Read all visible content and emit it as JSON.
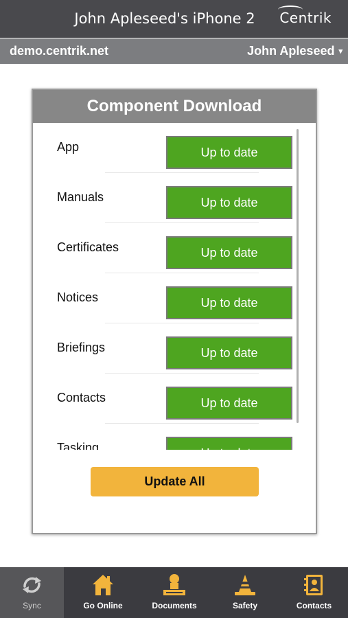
{
  "header": {
    "device_title": "John Apleseed's iPhone 2",
    "logo_text": "Centrik"
  },
  "subheader": {
    "server": "demo.centrik.net",
    "user": "John Apleseed",
    "user_caret": "▾"
  },
  "dialog": {
    "title": "Component Download",
    "components": [
      {
        "label": "App",
        "status": "Up to date"
      },
      {
        "label": "Manuals",
        "status": "Up to date"
      },
      {
        "label": "Certificates",
        "status": "Up to date"
      },
      {
        "label": "Notices",
        "status": "Up to date"
      },
      {
        "label": "Briefings",
        "status": "Up to date"
      },
      {
        "label": "Contacts",
        "status": "Up to date"
      },
      {
        "label": "Tasking",
        "status": "Up to date"
      }
    ],
    "update_all_label": "Update All"
  },
  "tabbar": {
    "tabs": [
      {
        "label": "Sync",
        "icon": "sync-icon",
        "active": true
      },
      {
        "label": "Go Online",
        "icon": "home-icon",
        "active": false
      },
      {
        "label": "Documents",
        "icon": "documents-icon",
        "active": false
      },
      {
        "label": "Safety",
        "icon": "cone-icon",
        "active": false
      },
      {
        "label": "Contacts",
        "icon": "contacts-icon",
        "active": false
      }
    ]
  },
  "colors": {
    "status_green": "#4ea520",
    "update_button": "#f2b43c",
    "icon_accent": "#f2b43c",
    "header_bg": "#49494d",
    "subheader_bg": "#7c7d80",
    "dialog_header_bg": "#878787",
    "tabbar_bg": "#3b3b40"
  }
}
